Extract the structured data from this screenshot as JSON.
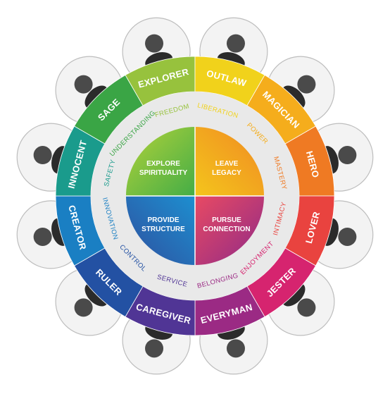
{
  "archetypes": [
    {
      "name": "EXPLORER",
      "motive": "FREEDOM",
      "color": "#97c23d"
    },
    {
      "name": "OUTLAW",
      "motive": "LIBERATION",
      "color": "#f1d21b"
    },
    {
      "name": "MAGICIAN",
      "motive": "POWER",
      "color": "#f5ad1c"
    },
    {
      "name": "HERO",
      "motive": "MASTERY",
      "color": "#ef7a23"
    },
    {
      "name": "LOVER",
      "motive": "INTIMACY",
      "color": "#e9433f"
    },
    {
      "name": "JESTER",
      "motive": "ENJOYMENT",
      "color": "#d6246f"
    },
    {
      "name": "EVERYMAN",
      "motive": "BELONGING",
      "color": "#9b2a84"
    },
    {
      "name": "CAREGIVER",
      "motive": "SERVICE",
      "color": "#503595"
    },
    {
      "name": "RULER",
      "motive": "CONTROL",
      "color": "#2351a3"
    },
    {
      "name": "CREATOR",
      "motive": "INNOVATION",
      "color": "#1a7fc3"
    },
    {
      "name": "INNOCENT",
      "motive": "SAFETY",
      "color": "#1a9b8c"
    },
    {
      "name": "SAGE",
      "motive": "UNDERSTANDING",
      "color": "#3aa545"
    }
  ],
  "quadrants": [
    {
      "id": "explore",
      "line1": "EXPLORE",
      "line2": "SPIRITUALITY"
    },
    {
      "id": "leave",
      "line1": "LEAVE",
      "line2": "LEGACY"
    },
    {
      "id": "provide",
      "line1": "PROVIDE",
      "line2": "STRUCTURE"
    },
    {
      "id": "pursue",
      "line1": "PURSUE",
      "line2": "CONNECTION"
    }
  ],
  "colors": {
    "inner_ring": "#e9e9e9",
    "petal_outline": "#bdbdbd",
    "explore_a": "#44ad46",
    "explore_b": "#b3d23a",
    "leave_a": "#f4c51c",
    "leave_b": "#f08a22",
    "provide_a": "#1d8fd0",
    "provide_b": "#2f4f9e",
    "pursue_a": "#e84a63",
    "pursue_b": "#8f2a88"
  }
}
